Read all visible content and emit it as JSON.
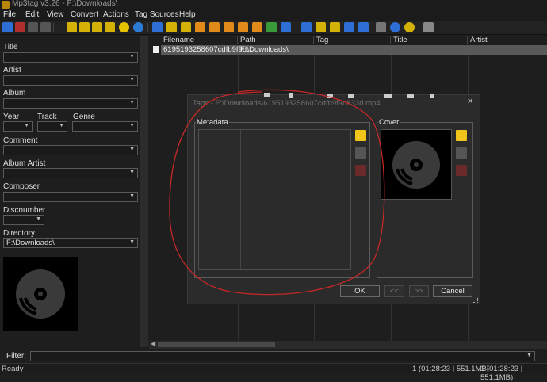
{
  "window": {
    "title": "Mp3tag v3.26  -  F:\\Downloads\\"
  },
  "menu": [
    "File",
    "Edit",
    "View",
    "Convert",
    "Actions",
    "Tag Sources",
    "Help"
  ],
  "fields": {
    "title_label": "Title",
    "artist_label": "Artist",
    "album_label": "Album",
    "year_label": "Year",
    "track_label": "Track",
    "genre_label": "Genre",
    "comment_label": "Comment",
    "album_artist_label": "Album Artist",
    "composer_label": "Composer",
    "discnumber_label": "Discnumber",
    "directory_label": "Directory",
    "directory_value": "F:\\Downloads\\"
  },
  "columns": [
    "Filename",
    "Path",
    "Tag",
    "Title",
    "Artist"
  ],
  "rows": [
    {
      "filename": "6195193258607cdfb9f9d...",
      "path": "F:\\Downloads\\",
      "tag": "",
      "title": "",
      "artist": ""
    }
  ],
  "dialog": {
    "title": "Tags - F:\\Downloads\\6195193258607cdfb9f9d833d.mp4",
    "metadata_label": "Metadata",
    "cover_label": "Cover",
    "ok_label": "OK",
    "prev_label": "<<",
    "next_label": ">>",
    "cancel_label": "Cancel",
    "close_glyph": "✕"
  },
  "filter": {
    "label": "Filter:"
  },
  "status": {
    "ready": "Ready",
    "selected": "1 (01:28:23 | 551.1MB)",
    "total": "1 (01:28:23 | 551.1MB)"
  },
  "colors": {
    "annotation": "#c62828",
    "selection": "#595959",
    "background": "#1e1e1e"
  }
}
